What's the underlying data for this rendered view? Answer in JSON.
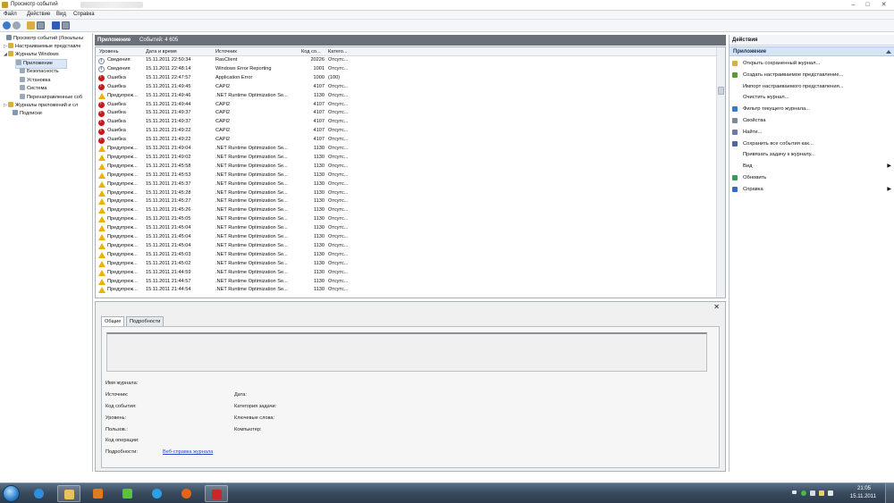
{
  "window": {
    "title": "Просмотр событий",
    "controls": {
      "minimize": "–",
      "maximize": "□",
      "close": "✕"
    }
  },
  "menubar": [
    "Файл",
    "Действие",
    "Вид",
    "Справка"
  ],
  "toolbar": {
    "icons": [
      "back-arrow-icon",
      "forward-arrow-icon",
      "folder-up-icon",
      "show-hide-tree-icon",
      "help-icon",
      "show-hide-action-pane-icon"
    ]
  },
  "tree": {
    "items": [
      {
        "label": "Просмотр событий (Локальны",
        "level": 0,
        "icon": "event-viewer-icon",
        "expander": ""
      },
      {
        "label": "Настраиваемые представле",
        "level": 1,
        "icon": "folder-icon",
        "expander": "▷"
      },
      {
        "label": "Журналы Windows",
        "level": 1,
        "icon": "folder-icon",
        "expander": "◢"
      },
      {
        "label": "Приложение",
        "level": 2,
        "icon": "log-icon",
        "expander": "",
        "selected": true
      },
      {
        "label": "Безопасность",
        "level": 2,
        "icon": "log-icon",
        "expander": ""
      },
      {
        "label": "Установка",
        "level": 2,
        "icon": "log-icon",
        "expander": ""
      },
      {
        "label": "Система",
        "level": 2,
        "icon": "log-icon",
        "expander": ""
      },
      {
        "label": "Перенаправленные соб",
        "level": 2,
        "icon": "log-icon",
        "expander": ""
      },
      {
        "label": "Журналы приложений и сл",
        "level": 1,
        "icon": "folder-icon",
        "expander": "▷"
      },
      {
        "label": "Подписки",
        "level": 1,
        "icon": "subscriptions-icon",
        "expander": ""
      }
    ]
  },
  "log": {
    "title": "Приложение",
    "count": "Событий: 4 605",
    "columns": [
      "Уровень",
      "Дата и время",
      "Источник",
      "Код со...",
      "Катего..."
    ],
    "rows": [
      {
        "type": "info",
        "level": "Сведения",
        "date": "15.11.2011 22:50:34",
        "source": "RasClient",
        "code": "20226",
        "cat": "Отсутс..."
      },
      {
        "type": "info",
        "level": "Сведения",
        "date": "15.11.2011 22:48:14",
        "source": "Windows Error Reporting",
        "code": "1001",
        "cat": "Отсутс..."
      },
      {
        "type": "error",
        "level": "Ошибка",
        "date": "15.11.2011 22:47:57",
        "source": "Application Error",
        "code": "1000",
        "cat": "(100)"
      },
      {
        "type": "error",
        "level": "Ошибка",
        "date": "15.11.2011 21:49:45",
        "source": "CAPI2",
        "code": "4107",
        "cat": "Отсутс..."
      },
      {
        "type": "warn",
        "level": "Предупреж...",
        "date": "15.11.2011 21:49:46",
        "source": ".NET Runtime Optimization Se...",
        "code": "1130",
        "cat": "Отсутс..."
      },
      {
        "type": "error",
        "level": "Ошибка",
        "date": "15.11.2011 21:49:44",
        "source": "CAPI2",
        "code": "4107",
        "cat": "Отсутс..."
      },
      {
        "type": "error",
        "level": "Ошибка",
        "date": "15.11.2011 21:49:37",
        "source": "CAPI2",
        "code": "4107",
        "cat": "Отсутс..."
      },
      {
        "type": "error",
        "level": "Ошибка",
        "date": "15.11.2011 21:49:37",
        "source": "CAPI2",
        "code": "4107",
        "cat": "Отсутс..."
      },
      {
        "type": "error",
        "level": "Ошибка",
        "date": "15.11.2011 21:49:22",
        "source": "CAPI2",
        "code": "4107",
        "cat": "Отсутс..."
      },
      {
        "type": "error",
        "level": "Ошибка",
        "date": "15.11.2011 21:49:22",
        "source": "CAPI2",
        "code": "4107",
        "cat": "Отсутс..."
      },
      {
        "type": "warn",
        "level": "Предупреж...",
        "date": "15.11.2011 21:49:04",
        "source": ".NET Runtime Optimization Se...",
        "code": "1130",
        "cat": "Отсутс..."
      },
      {
        "type": "warn",
        "level": "Предупреж...",
        "date": "15.11.2011 21:49:02",
        "source": ".NET Runtime Optimization Se...",
        "code": "1130",
        "cat": "Отсутс..."
      },
      {
        "type": "warn",
        "level": "Предупреж...",
        "date": "15.11.2011 21:45:58",
        "source": ".NET Runtime Optimization Se...",
        "code": "1130",
        "cat": "Отсутс..."
      },
      {
        "type": "warn",
        "level": "Предупреж...",
        "date": "15.11.2011 21:45:53",
        "source": ".NET Runtime Optimization Se...",
        "code": "1130",
        "cat": "Отсутс..."
      },
      {
        "type": "warn",
        "level": "Предупреж...",
        "date": "15.11.2011 21:45:37",
        "source": ".NET Runtime Optimization Se...",
        "code": "1130",
        "cat": "Отсутс..."
      },
      {
        "type": "warn",
        "level": "Предупреж...",
        "date": "15.11.2011 21:45:28",
        "source": ".NET Runtime Optimization Se...",
        "code": "1130",
        "cat": "Отсутс..."
      },
      {
        "type": "warn",
        "level": "Предупреж...",
        "date": "15.11.2011 21:45:27",
        "source": ".NET Runtime Optimization Se...",
        "code": "1130",
        "cat": "Отсутс..."
      },
      {
        "type": "warn",
        "level": "Предупреж...",
        "date": "15.11.2011 21:45:26",
        "source": ".NET Runtime Optimization Se...",
        "code": "1130",
        "cat": "Отсутс..."
      },
      {
        "type": "warn",
        "level": "Предупреж...",
        "date": "15.11.2011 21:45:05",
        "source": ".NET Runtime Optimization Se...",
        "code": "1130",
        "cat": "Отсутс..."
      },
      {
        "type": "warn",
        "level": "Предупреж...",
        "date": "15.11.2011 21:45:04",
        "source": ".NET Runtime Optimization Se...",
        "code": "1130",
        "cat": "Отсутс..."
      },
      {
        "type": "warn",
        "level": "Предупреж...",
        "date": "15.11.2011 21:45:04",
        "source": ".NET Runtime Optimization Se...",
        "code": "1130",
        "cat": "Отсутс..."
      },
      {
        "type": "warn",
        "level": "Предупреж...",
        "date": "15.11.2011 21:45:04",
        "source": ".NET Runtime Optimization Se...",
        "code": "1130",
        "cat": "Отсутс..."
      },
      {
        "type": "warn",
        "level": "Предупреж...",
        "date": "15.11.2011 21:45:03",
        "source": ".NET Runtime Optimization Se...",
        "code": "1130",
        "cat": "Отсутс..."
      },
      {
        "type": "warn",
        "level": "Предупреж...",
        "date": "15.11.2011 21:45:02",
        "source": ".NET Runtime Optimization Se...",
        "code": "1130",
        "cat": "Отсутс..."
      },
      {
        "type": "warn",
        "level": "Предупреж...",
        "date": "15.11.2011 21:44:59",
        "source": ".NET Runtime Optimization Se...",
        "code": "1130",
        "cat": "Отсутс..."
      },
      {
        "type": "warn",
        "level": "Предупреж...",
        "date": "15.11.2011 21:44:57",
        "source": ".NET Runtime Optimization Se...",
        "code": "1130",
        "cat": "Отсутс..."
      },
      {
        "type": "warn",
        "level": "Предупреж...",
        "date": "15.11.2011 21:44:54",
        "source": ".NET Runtime Optimization Se...",
        "code": "1130",
        "cat": "Отсутс..."
      }
    ]
  },
  "details": {
    "close": "✕",
    "tabs": [
      "Общие",
      "Подробности"
    ],
    "left_fields": [
      "Имя журнала:",
      "Источник:",
      "Код события:",
      "Уровень:",
      "Пользов.:",
      "Код операции:",
      "Подробности:"
    ],
    "right_fields": [
      "Дата:",
      "Категория задачи:",
      "Ключевые слова:",
      "Компьютер:"
    ],
    "link": "Веб-справка журнала"
  },
  "actions": {
    "header": "Действия",
    "section": "Приложение",
    "items": [
      {
        "label": "Открыть сохраненный журнал...",
        "icon": "open-folder-icon",
        "color": "#d8b040",
        "arrow": ""
      },
      {
        "label": "Создать настраиваемое представление...",
        "icon": "filter-create-icon",
        "color": "#5a9a3a",
        "arrow": ""
      },
      {
        "label": "Импорт настраиваемого представления...",
        "icon": "",
        "color": "",
        "arrow": ""
      },
      {
        "label": "Очистить журнал...",
        "icon": "",
        "color": "",
        "arrow": ""
      },
      {
        "label": "Фильтр текущего журнала...",
        "icon": "filter-icon",
        "color": "#3a7ac0",
        "arrow": ""
      },
      {
        "label": "Свойства",
        "icon": "properties-icon",
        "color": "#7a8a9a",
        "arrow": ""
      },
      {
        "label": "Найти...",
        "icon": "find-icon",
        "color": "#6a7aa0",
        "arrow": ""
      },
      {
        "label": "Сохранить все события как...",
        "icon": "save-icon",
        "color": "#4a6a9a",
        "arrow": ""
      },
      {
        "label": "Привязать задачу к журналу...",
        "icon": "",
        "color": "",
        "arrow": ""
      },
      {
        "label": "Вид",
        "icon": "",
        "color": "",
        "arrow": "▶"
      },
      {
        "label": "Обновить",
        "icon": "refresh-icon",
        "color": "#3a9a5a",
        "arrow": ""
      },
      {
        "label": "Справка",
        "icon": "help-icon",
        "color": "#3a6ac8",
        "arrow": "▶"
      }
    ]
  },
  "taskbar": {
    "apps": [
      {
        "name": "internet-explorer-icon",
        "color": "#2f8ee0"
      },
      {
        "name": "file-explorer-icon",
        "color": "#e8c25a"
      },
      {
        "name": "media-player-icon",
        "color": "#e07a20"
      },
      {
        "name": "icq-icon",
        "color": "#5cc23a"
      },
      {
        "name": "skype-icon",
        "color": "#2aa0e8"
      },
      {
        "name": "firefox-icon",
        "color": "#e8631a"
      },
      {
        "name": "event-viewer-icon",
        "color": "#c82828"
      }
    ],
    "time": "21:05",
    "date": "15.11.2011",
    "tray_icons": [
      "show-hidden-icons-icon",
      "network-icon",
      "notification-icon",
      "flag-icon",
      "volume-icon"
    ]
  }
}
